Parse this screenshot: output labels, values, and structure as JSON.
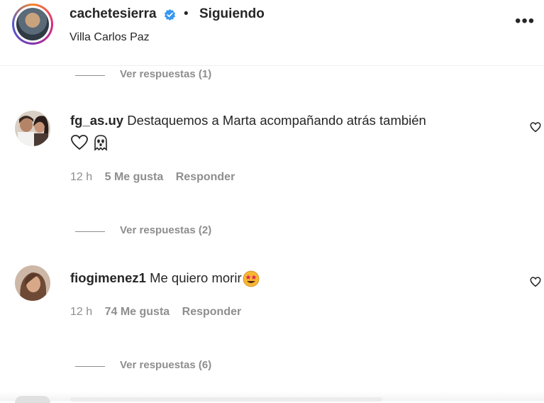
{
  "post_header": {
    "username": "cachetesierra",
    "separator": "•",
    "follow_status": "Siguiendo",
    "location": "Villa Carlos Paz",
    "more_label": "•••"
  },
  "comments": [
    {
      "username": "fg_as.uy",
      "text": "Destaquemos a Marta acompañando atrás también",
      "time": "12 h",
      "likes": "5 Me gusta",
      "reply_label": "Responder",
      "view_replies": "Ver respuestas (2)"
    },
    {
      "username": "fiogimenez1",
      "text": "Me quiero morir",
      "time": "12 h",
      "likes": "74 Me gusta",
      "reply_label": "Responder",
      "view_replies": "Ver respuestas (6)"
    }
  ],
  "top_view_replies": "Ver respuestas (1)",
  "icons": {
    "verified": "verified-badge-icon",
    "like": "heart-outline-icon",
    "more": "more-options-icon"
  },
  "colors": {
    "verified_blue": "#3897f0",
    "muted_gray": "#8e8e8e",
    "text": "#262626"
  }
}
